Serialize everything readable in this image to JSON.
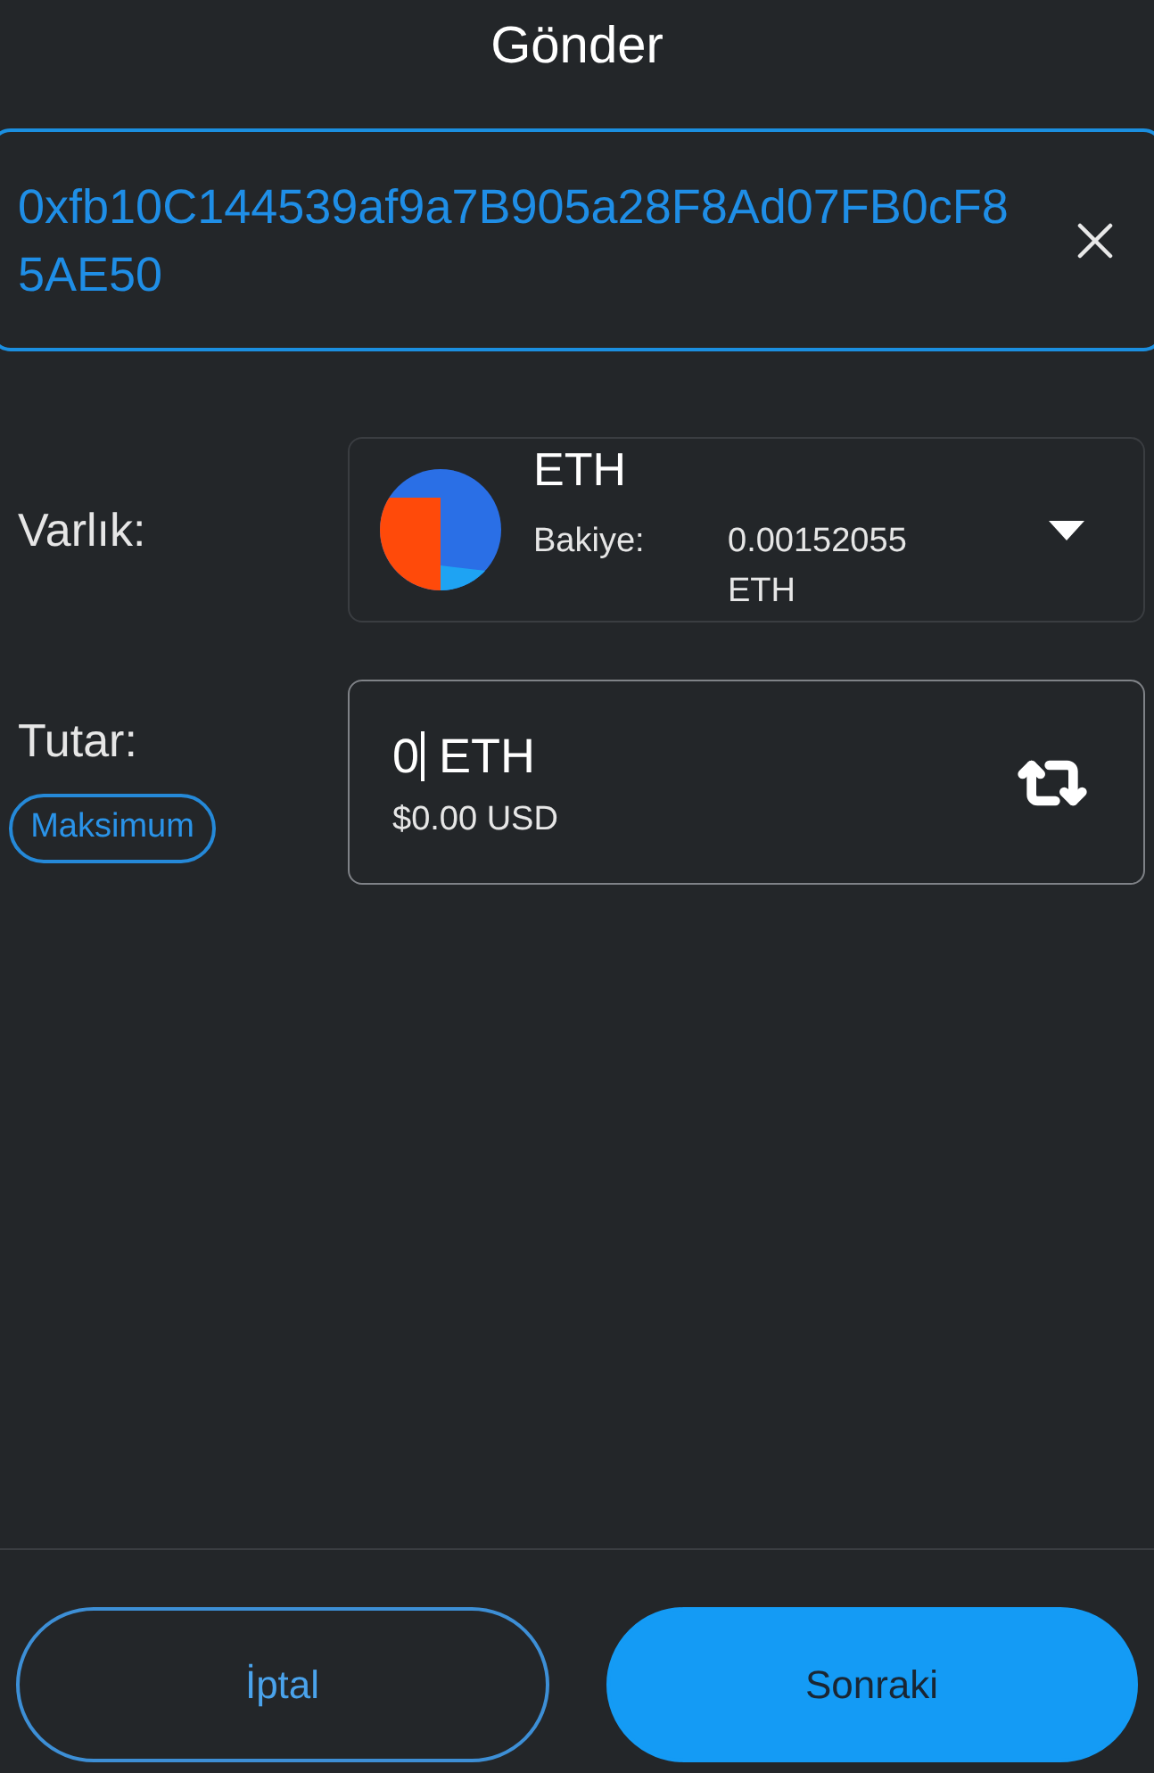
{
  "title": "Gönder",
  "recipient": {
    "address": "0xfb10C144539af9a7B905a28F8Ad07FB0cF85AE50"
  },
  "asset": {
    "label": "Varlık:",
    "symbol": "ETH",
    "balance_label": "Bakiye:",
    "balance_value": "0.00152055 ETH"
  },
  "amount": {
    "label": "Tutar:",
    "max_button": "Maksimum",
    "value": "0",
    "focused": true,
    "unit": "ETH",
    "fiat": "$0.00 USD"
  },
  "buttons": [
    {
      "label": "İptal",
      "kind": "secondary"
    },
    {
      "label": "Sonraki",
      "kind": "primary"
    }
  ]
}
